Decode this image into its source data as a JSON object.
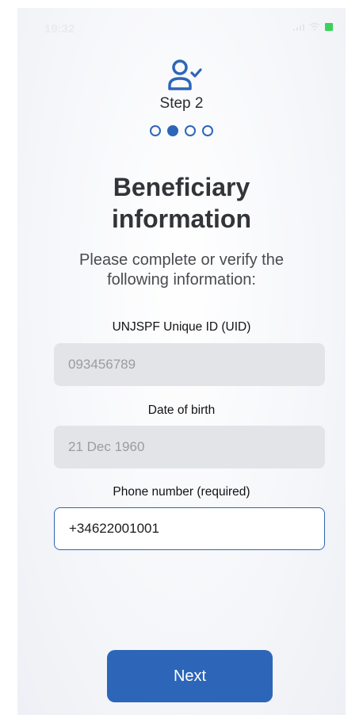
{
  "status_bar": {
    "time": "19:32"
  },
  "header": {
    "icon": "user-check-icon",
    "step_label": "Step 2",
    "total_steps": 4,
    "current_step": 2
  },
  "title": {
    "line1": "Beneficiary",
    "line2": "information"
  },
  "subtitle": "Please complete or verify the following information:",
  "fields": {
    "uid": {
      "label": "UNJSPF Unique ID (UID)",
      "value": "093456789"
    },
    "dob": {
      "label": "Date of birth",
      "value": "21 Dec 1960"
    },
    "phone": {
      "label": "Phone number (required)",
      "value": "+34622001001"
    }
  },
  "actions": {
    "next_label": "Next"
  },
  "colors": {
    "accent": "#2d66b8",
    "disabled_field": "#e3e4e7",
    "title_text": "#333438"
  }
}
